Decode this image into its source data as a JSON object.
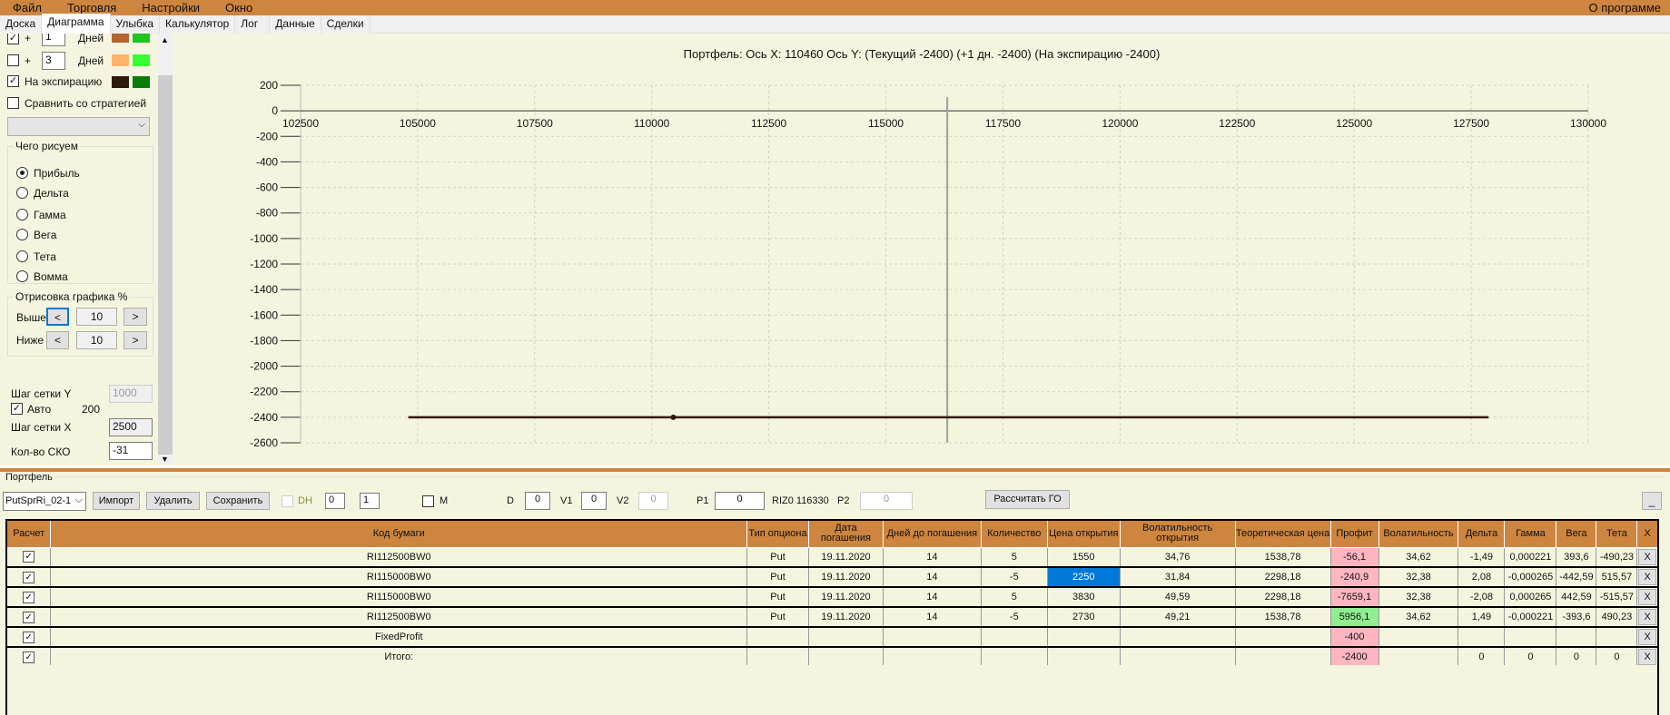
{
  "menu": {
    "items": [
      "Файл",
      "Торговля",
      "Настройки",
      "Окно"
    ],
    "about": "О программе"
  },
  "tabs": [
    "Доска",
    "Диаграмма",
    "Улыбка",
    "Калькулятор",
    "Лог",
    "Данные",
    "Сделки"
  ],
  "left": {
    "row1": {
      "checked": true,
      "plus": "+",
      "days": "1",
      "days_label": "Дней",
      "colors": [
        "#b5652e",
        "#1fc41f"
      ]
    },
    "row2": {
      "checked": false,
      "plus": "+",
      "days": "3",
      "days_label": "Дней",
      "colors": [
        "#ffb46e",
        "#33ff33"
      ]
    },
    "row3": {
      "checked": true,
      "label": "На экспирацию",
      "colors": [
        "#2e1a08",
        "#087d08"
      ]
    },
    "compare": {
      "checked": false,
      "label": "Сравнить со стратегией"
    },
    "combo_value": "",
    "draw_group": {
      "title": "Чего рисуем",
      "options": [
        "Прибыль",
        "Дельта",
        "Гамма",
        "Вега",
        "Тета",
        "Вомма"
      ],
      "selected": 0
    },
    "range_group": {
      "title": "Отрисовка графика %",
      "above_label": "Выше",
      "above_value": "10",
      "below_label": "Ниже",
      "below_value": "10",
      "dec": "<",
      "inc": ">"
    },
    "grid_y_label": "Шаг сетки Y",
    "grid_y_value": "1000",
    "auto_label": "Авто",
    "auto_checked": true,
    "auto_value": "200",
    "grid_x_label": "Шаг сетки X",
    "grid_x_value": "2500",
    "sko_label": "Кол-во СКО",
    "sko_value": "-31"
  },
  "chart_data": {
    "type": "line",
    "title": "Портфель: Ось X: 110460 Ось Y:  (Текущий -2400)  (+1 дн. -2400)  (На экспирацию -2400)",
    "xlim": [
      102500,
      130000
    ],
    "ylim": [
      -2600,
      200
    ],
    "xticks": [
      102500,
      105000,
      107500,
      110000,
      112500,
      115000,
      117500,
      120000,
      122500,
      125000,
      127500,
      130000
    ],
    "yticks": [
      200,
      0,
      -200,
      -400,
      -600,
      -800,
      -1000,
      -1200,
      -1400,
      -1600,
      -1800,
      -2000,
      -2200,
      -2400,
      -2600
    ],
    "series": [
      {
        "name": "На экспирацию",
        "x": [
          104800,
          127870
        ],
        "y": [
          -2400,
          -2400
        ],
        "color": "#2e1a08"
      }
    ],
    "marker": {
      "x": 110460,
      "y": -2400
    },
    "current_price_line": 116310,
    "grid": true
  },
  "portfolio": {
    "title": "Портфель",
    "strategy": "PutSprRi_02-1",
    "import": "Импорт",
    "delete": "Удалить",
    "save": "Сохранить",
    "dh_label": "DH",
    "spin1": "0",
    "spin2": "1",
    "m_label": "M",
    "d_label": "D",
    "d_value": "0",
    "v1_label": "V1",
    "v1_value": "0",
    "v2_label": "V2",
    "v2_value": "0",
    "p1_label": "P1",
    "p1_value": "0",
    "riz": "RIZ0 116330",
    "p2_label": "P2",
    "p2_value": "0",
    "calc_go": "Рассчитать ГО",
    "minimize": "_"
  },
  "table": {
    "headers": [
      "Расчет",
      "Код бумаги",
      "Тип опциона",
      "Дата погашения",
      "Дней до погашения",
      "Количество",
      "Цена открытия",
      "Волатильность открытия",
      "Теоретическая цена",
      "Профит",
      "Волатильность",
      "Дельта",
      "Гамма",
      "Вега",
      "Тета",
      "X"
    ],
    "rows": [
      [
        "RI112500BW0",
        "Put",
        "19.11.2020",
        "14",
        "5",
        "1550",
        "34,76",
        "1538,78",
        "-56,1",
        "34,62",
        "-1,49",
        "0,000221",
        "393,6",
        "-490,23"
      ],
      [
        "RI115000BW0",
        "Put",
        "19.11.2020",
        "14",
        "-5",
        "2250",
        "31,84",
        "2298,18",
        "-240,9",
        "32,38",
        "2,08",
        "-0,000265",
        "-442,59",
        "515,57"
      ],
      [
        "RI115000BW0",
        "Put",
        "19.11.2020",
        "14",
        "5",
        "3830",
        "49,59",
        "2298,18",
        "-7659,1",
        "32,38",
        "-2,08",
        "0,000265",
        "442,59",
        "-515,57"
      ],
      [
        "RI112500BW0",
        "Put",
        "19.11.2020",
        "14",
        "-5",
        "2730",
        "49,21",
        "1538,78",
        "5956,1",
        "34,62",
        "1,49",
        "-0,000221",
        "-393,6",
        "490,23"
      ],
      [
        "FixedProfit",
        "",
        "",
        "",
        "",
        "",
        "",
        "",
        "-400",
        "",
        "",
        "",
        "",
        ""
      ],
      [
        "Итого:",
        "",
        "",
        "",
        "",
        "",
        "",
        "",
        "-2400",
        "",
        "0",
        "0",
        "0",
        "0"
      ]
    ],
    "row_x": "X",
    "profit_colors": {
      "neg": "#ffb6c1",
      "pos": "#90ee90"
    },
    "selected_color": "#0078d7"
  }
}
